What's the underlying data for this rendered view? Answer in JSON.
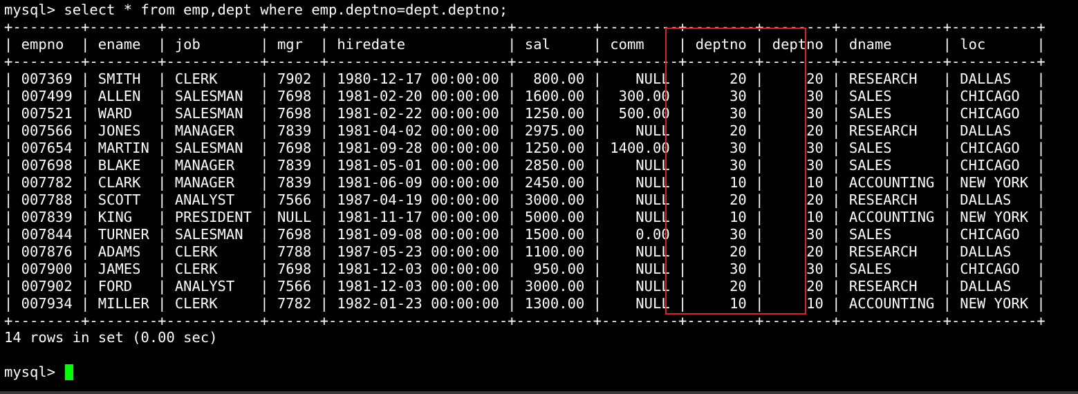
{
  "terminal": {
    "command_line": "mysql> select * from emp,dept where emp.deptno=dept.deptno;",
    "prompt": "mysql> ",
    "result_summary": "14 rows in set (0.00 sec)",
    "highlight_color": "#e02020",
    "cursor_color": "#00ff00",
    "background_color": "#000000",
    "text_color": "#ffffff"
  },
  "table": {
    "headers": [
      "empno",
      "ename",
      "job",
      "mgr",
      "hiredate",
      "sal",
      "comm",
      "deptno",
      "deptno",
      "dname",
      "loc"
    ],
    "rows": [
      [
        "007369",
        "SMITH",
        "CLERK",
        "7902",
        "1980-12-17 00:00:00",
        "800.00",
        "NULL",
        "20",
        "20",
        "RESEARCH",
        "DALLAS"
      ],
      [
        "007499",
        "ALLEN",
        "SALESMAN",
        "7698",
        "1981-02-20 00:00:00",
        "1600.00",
        "300.00",
        "30",
        "30",
        "SALES",
        "CHICAGO"
      ],
      [
        "007521",
        "WARD",
        "SALESMAN",
        "7698",
        "1981-02-22 00:00:00",
        "1250.00",
        "500.00",
        "30",
        "30",
        "SALES",
        "CHICAGO"
      ],
      [
        "007566",
        "JONES",
        "MANAGER",
        "7839",
        "1981-04-02 00:00:00",
        "2975.00",
        "NULL",
        "20",
        "20",
        "RESEARCH",
        "DALLAS"
      ],
      [
        "007654",
        "MARTIN",
        "SALESMAN",
        "7698",
        "1981-09-28 00:00:00",
        "1250.00",
        "1400.00",
        "30",
        "30",
        "SALES",
        "CHICAGO"
      ],
      [
        "007698",
        "BLAKE",
        "MANAGER",
        "7839",
        "1981-05-01 00:00:00",
        "2850.00",
        "NULL",
        "30",
        "30",
        "SALES",
        "CHICAGO"
      ],
      [
        "007782",
        "CLARK",
        "MANAGER",
        "7839",
        "1981-06-09 00:00:00",
        "2450.00",
        "NULL",
        "10",
        "10",
        "ACCOUNTING",
        "NEW YORK"
      ],
      [
        "007788",
        "SCOTT",
        "ANALYST",
        "7566",
        "1987-04-19 00:00:00",
        "3000.00",
        "NULL",
        "20",
        "20",
        "RESEARCH",
        "DALLAS"
      ],
      [
        "007839",
        "KING",
        "PRESIDENT",
        "NULL",
        "1981-11-17 00:00:00",
        "5000.00",
        "NULL",
        "10",
        "10",
        "ACCOUNTING",
        "NEW YORK"
      ],
      [
        "007844",
        "TURNER",
        "SALESMAN",
        "7698",
        "1981-09-08 00:00:00",
        "1500.00",
        "0.00",
        "30",
        "30",
        "SALES",
        "CHICAGO"
      ],
      [
        "007876",
        "ADAMS",
        "CLERK",
        "7788",
        "1987-05-23 00:00:00",
        "1100.00",
        "NULL",
        "20",
        "20",
        "RESEARCH",
        "DALLAS"
      ],
      [
        "007900",
        "JAMES",
        "CLERK",
        "7698",
        "1981-12-03 00:00:00",
        "950.00",
        "NULL",
        "30",
        "30",
        "SALES",
        "CHICAGO"
      ],
      [
        "007902",
        "FORD",
        "ANALYST",
        "7566",
        "1981-12-03 00:00:00",
        "3000.00",
        "NULL",
        "20",
        "20",
        "RESEARCH",
        "DALLAS"
      ],
      [
        "007934",
        "MILLER",
        "CLERK",
        "7782",
        "1982-01-23 00:00:00",
        "1300.00",
        "NULL",
        "10",
        "10",
        "ACCOUNTING",
        "NEW YORK"
      ]
    ]
  }
}
